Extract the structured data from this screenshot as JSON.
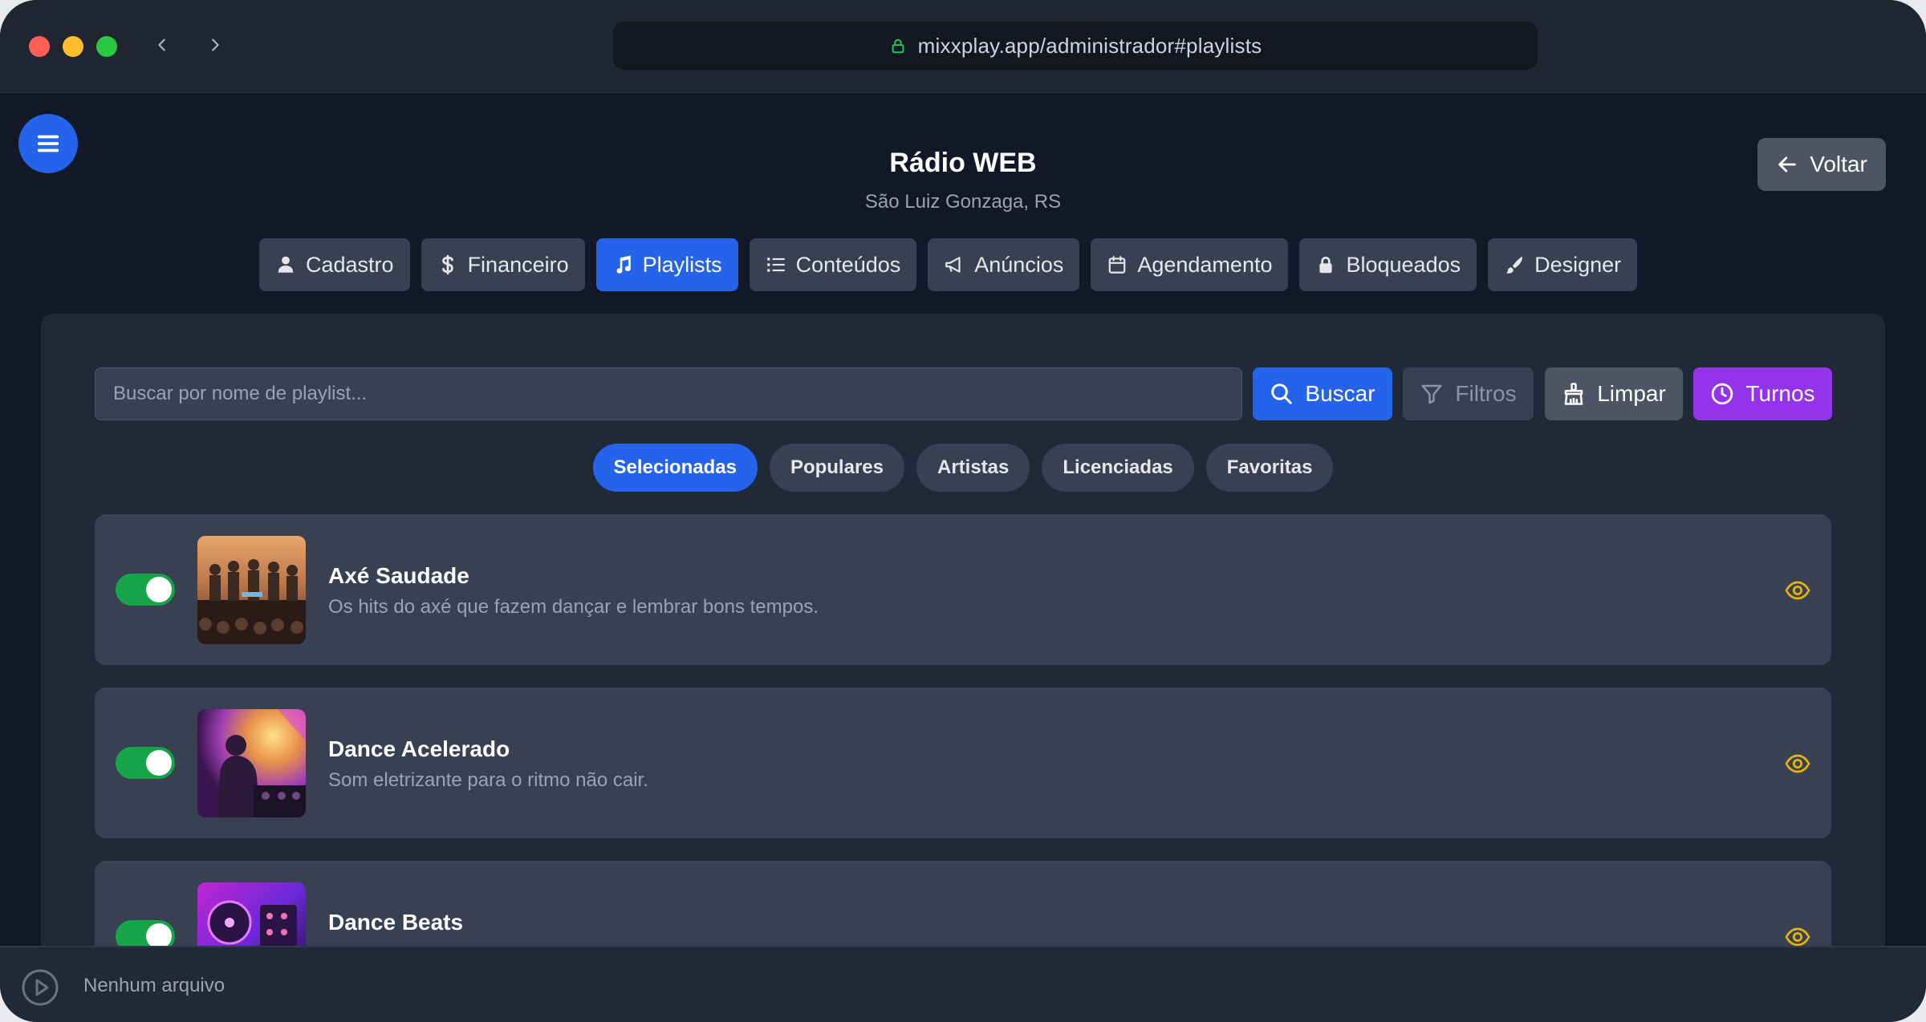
{
  "browser": {
    "url": "mixxplay.app/administrador#playlists"
  },
  "header": {
    "title": "Rádio WEB",
    "subtitle": "São Luiz Gonzaga, RS",
    "back_label": "Voltar"
  },
  "tabs": [
    {
      "label": "Cadastro",
      "icon": "user-icon"
    },
    {
      "label": "Financeiro",
      "icon": "dollar-icon"
    },
    {
      "label": "Playlists",
      "icon": "music-icon",
      "active": true
    },
    {
      "label": "Conteúdos",
      "icon": "list-icon"
    },
    {
      "label": "Anúncios",
      "icon": "megaphone-icon"
    },
    {
      "label": "Agendamento",
      "icon": "calendar-icon"
    },
    {
      "label": "Bloqueados",
      "icon": "lock-icon"
    },
    {
      "label": "Designer",
      "icon": "brush-icon"
    }
  ],
  "search": {
    "placeholder": "Buscar por nome de playlist...",
    "value": "",
    "buscar_label": "Buscar",
    "filtros_label": "Filtros",
    "limpar_label": "Limpar",
    "turnos_label": "Turnos"
  },
  "filters": [
    {
      "label": "Selecionadas",
      "active": true
    },
    {
      "label": "Populares"
    },
    {
      "label": "Artistas"
    },
    {
      "label": "Licenciadas"
    },
    {
      "label": "Favoritas"
    }
  ],
  "playlists": [
    {
      "title": "Axé Saudade",
      "description": "Os hits do axé que fazem dançar e lembrar bons tempos.",
      "enabled": true
    },
    {
      "title": "Dance Acelerado",
      "description": "Som eletrizante para o ritmo não cair.",
      "enabled": true
    },
    {
      "title": "Dance Beats",
      "description": "",
      "enabled": true
    }
  ],
  "player": {
    "status": "Nenhum arquivo"
  },
  "colors": {
    "accent": "#2563eb",
    "turnos": "#9333ea",
    "toggle_on": "#16a34a",
    "eye": "#eab308",
    "background": "#111827",
    "panel": "#1f2937",
    "card": "#374151"
  }
}
